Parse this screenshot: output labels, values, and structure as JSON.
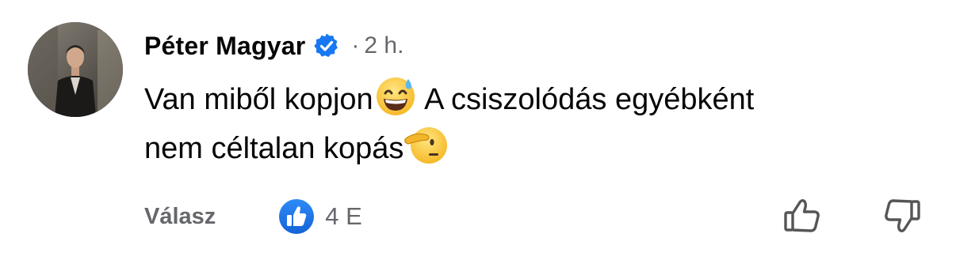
{
  "comment": {
    "author": "Péter Magyar",
    "verified": true,
    "meta_separator": "·",
    "timestamp": "2 h.",
    "text_line1_a": "Van miből kopjon",
    "emoji1": "sweat-smile-emoji",
    "text_line1_b": " A csiszolódás egyébként",
    "text_line2": "nem céltalan kopás",
    "emoji2": "saluting-face-emoji"
  },
  "actions": {
    "reply_label": "Válasz",
    "reaction_icon": "like-icon",
    "reaction_count": "4 E",
    "upvote_icon": "thumbs-up-outline-icon",
    "downvote_icon": "thumbs-down-outline-icon"
  },
  "colors": {
    "verified_blue": "#1877f2",
    "secondary_text": "#65676b",
    "primary_text": "#050505",
    "like_blue": "#1b74e4"
  }
}
